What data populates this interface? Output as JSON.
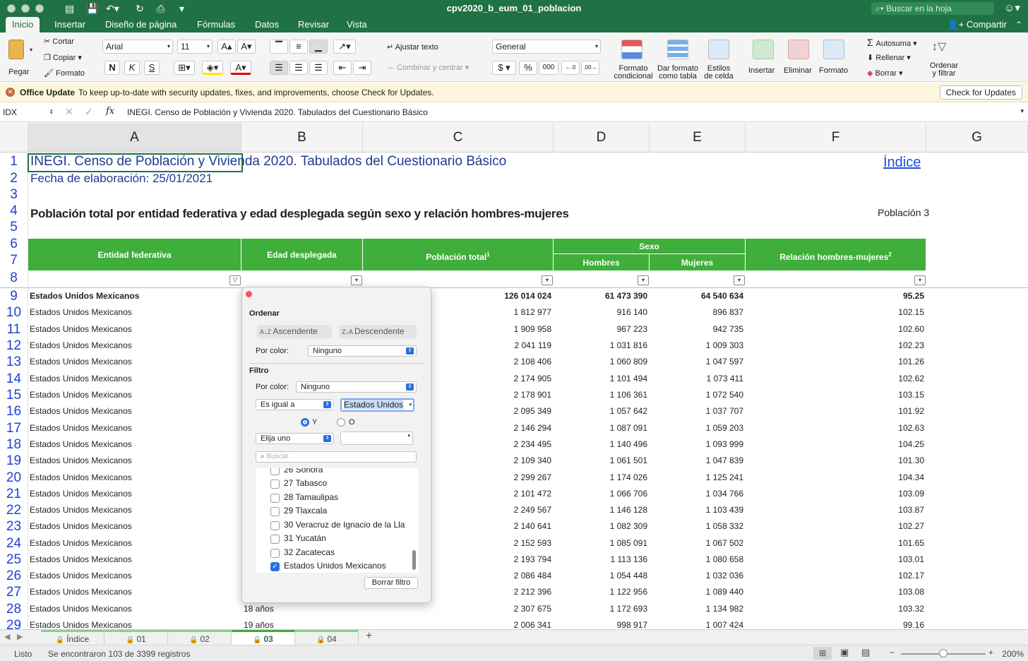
{
  "window": {
    "title": "cpv2020_b_eum_01_poblacion",
    "search_placeholder": "Buscar en la hoja"
  },
  "ribbon_tabs": [
    "Inicio",
    "Insertar",
    "Diseño de página",
    "Fórmulas",
    "Datos",
    "Revisar",
    "Vista"
  ],
  "share_label": "Compartir",
  "ribbon": {
    "paste": "Pegar",
    "cut": "Cortar",
    "copy": "Copiar",
    "format_painter": "Formato",
    "font_name": "Arial",
    "font_size": "11",
    "bold": "N",
    "italic": "K",
    "underline": "S",
    "wrap_text": "Ajustar texto",
    "merge_center": "Combinar y centrar",
    "number_format": "General",
    "currency": "$",
    "percent": "%",
    "thousands": "000",
    "cond_format": [
      "Formato",
      "condicional"
    ],
    "table_format": [
      "Dar formato",
      "como tabla"
    ],
    "cell_styles": [
      "Estilos",
      "de celda"
    ],
    "insert": "Insertar",
    "delete": "Eliminar",
    "format": "Formato",
    "autosum": "Autosuma",
    "fill": "Rellenar",
    "clear": "Borrar",
    "sort_filter": [
      "Ordenar",
      "y filtrar"
    ]
  },
  "update_bar": {
    "title": "Office Update",
    "message": "To keep up-to-date with security updates, fixes, and improvements, choose Check for Updates.",
    "button": "Check for Updates"
  },
  "formula_bar": {
    "name_box": "IDX",
    "fx": "fx",
    "content": "INEGI. Censo de Población y Vivienda 2020. Tabulados del Cuestionario Básico"
  },
  "columns": [
    "A",
    "B",
    "C",
    "D",
    "E",
    "F",
    "G"
  ],
  "sheet": {
    "title": "INEGI. Censo de Población y Vivienda 2020. Tabulados del Cuestionario Básico",
    "date": "Fecha de elaboración: 25/01/2021",
    "index_link": "Índice",
    "subtitle": "Población total por entidad federativa y edad desplegada según sexo y relación hombres-mujeres",
    "table_id": "Población 3",
    "headers": {
      "entity": "Entidad federativa",
      "age": "Edad desplegada",
      "total": "Población total",
      "total_sup": "1",
      "sex": "Sexo",
      "men": "Hombres",
      "women": "Mujeres",
      "ratio": "Relación hombres-mujeres",
      "ratio_sup": "2"
    }
  },
  "rows": [
    {
      "n": "9",
      "entity": "Estados Unidos Mexicanos",
      "age": "",
      "total": "126 014 024",
      "men": "61 473 390",
      "women": "64 540 634",
      "ratio": "95.25",
      "bold": true
    },
    {
      "n": "10",
      "entity": "Estados Unidos Mexicanos",
      "age": "",
      "total": "1 812 977",
      "men": "916 140",
      "women": "896 837",
      "ratio": "102.15"
    },
    {
      "n": "11",
      "entity": "Estados Unidos Mexicanos",
      "age": "",
      "total": "1 909 958",
      "men": "967 223",
      "women": "942 735",
      "ratio": "102.60"
    },
    {
      "n": "12",
      "entity": "Estados Unidos Mexicanos",
      "age": "",
      "total": "2 041 119",
      "men": "1 031 816",
      "women": "1 009 303",
      "ratio": "102.23"
    },
    {
      "n": "13",
      "entity": "Estados Unidos Mexicanos",
      "age": "",
      "total": "2 108 406",
      "men": "1 060 809",
      "women": "1 047 597",
      "ratio": "101.26"
    },
    {
      "n": "14",
      "entity": "Estados Unidos Mexicanos",
      "age": "",
      "total": "2 174 905",
      "men": "1 101 494",
      "women": "1 073 411",
      "ratio": "102.62"
    },
    {
      "n": "15",
      "entity": "Estados Unidos Mexicanos",
      "age": "",
      "total": "2 178 901",
      "men": "1 106 361",
      "women": "1 072 540",
      "ratio": "103.15"
    },
    {
      "n": "16",
      "entity": "Estados Unidos Mexicanos",
      "age": "",
      "total": "2 095 349",
      "men": "1 057 642",
      "women": "1 037 707",
      "ratio": "101.92"
    },
    {
      "n": "17",
      "entity": "Estados Unidos Mexicanos",
      "age": "",
      "total": "2 146 294",
      "men": "1 087 091",
      "women": "1 059 203",
      "ratio": "102.63"
    },
    {
      "n": "18",
      "entity": "Estados Unidos Mexicanos",
      "age": "",
      "total": "2 234 495",
      "men": "1 140 496",
      "women": "1 093 999",
      "ratio": "104.25"
    },
    {
      "n": "19",
      "entity": "Estados Unidos Mexicanos",
      "age": "",
      "total": "2 109 340",
      "men": "1 061 501",
      "women": "1 047 839",
      "ratio": "101.30"
    },
    {
      "n": "20",
      "entity": "Estados Unidos Mexicanos",
      "age": "",
      "total": "2 299 267",
      "men": "1 174 026",
      "women": "1 125 241",
      "ratio": "104.34"
    },
    {
      "n": "21",
      "entity": "Estados Unidos Mexicanos",
      "age": "",
      "total": "2 101 472",
      "men": "1 066 706",
      "women": "1 034 766",
      "ratio": "103.09"
    },
    {
      "n": "22",
      "entity": "Estados Unidos Mexicanos",
      "age": "",
      "total": "2 249 567",
      "men": "1 146 128",
      "women": "1 103 439",
      "ratio": "103.87"
    },
    {
      "n": "23",
      "entity": "Estados Unidos Mexicanos",
      "age": "",
      "total": "2 140 641",
      "men": "1 082 309",
      "women": "1 058 332",
      "ratio": "102.27"
    },
    {
      "n": "24",
      "entity": "Estados Unidos Mexicanos",
      "age": "",
      "total": "2 152 593",
      "men": "1 085 091",
      "women": "1 067 502",
      "ratio": "101.65"
    },
    {
      "n": "25",
      "entity": "Estados Unidos Mexicanos",
      "age": "",
      "total": "2 193 794",
      "men": "1 113 136",
      "women": "1 080 658",
      "ratio": "103.01"
    },
    {
      "n": "26",
      "entity": "Estados Unidos Mexicanos",
      "age": "",
      "total": "2 086 484",
      "men": "1 054 448",
      "women": "1 032 036",
      "ratio": "102.17"
    },
    {
      "n": "27",
      "entity": "Estados Unidos Mexicanos",
      "age": "",
      "total": "2 212 396",
      "men": "1 122 956",
      "women": "1 089 440",
      "ratio": "103.08"
    },
    {
      "n": "28",
      "entity": "Estados Unidos Mexicanos",
      "age": "18 años",
      "total": "2 307 675",
      "men": "1 172 693",
      "women": "1 134 982",
      "ratio": "103.32"
    },
    {
      "n": "29",
      "entity": "Estados Unidos Mexicanos",
      "age": "19 años",
      "total": "2 006 341",
      "men": "998 917",
      "women": "1 007 424",
      "ratio": "99.16"
    }
  ],
  "filter_popup": {
    "sort_label": "Ordenar",
    "ascending": "Ascendente",
    "descending": "Descendente",
    "by_color": "Por color:",
    "none": "Ninguno",
    "filter_label": "Filtro",
    "condition": "Es igual a",
    "condition_value": "Estados Unidos",
    "and": "Y",
    "or": "O",
    "choose": "Elija uno",
    "search_placeholder": "Buscar",
    "items": [
      {
        "label": "26 Sonora",
        "checked": false
      },
      {
        "label": "27 Tabasco",
        "checked": false
      },
      {
        "label": "28 Tamaulipas",
        "checked": false
      },
      {
        "label": "29 Tlaxcala",
        "checked": false
      },
      {
        "label": "30 Veracruz de Ignacio de la Lla",
        "checked": false
      },
      {
        "label": "31 Yucatán",
        "checked": false
      },
      {
        "label": "32 Zacatecas",
        "checked": false
      },
      {
        "label": "Estados Unidos Mexicanos",
        "checked": true
      }
    ],
    "clear_filter": "Borrar filtro"
  },
  "sheet_tabs": [
    {
      "label": "Índice",
      "active": false
    },
    {
      "label": "01",
      "active": false
    },
    {
      "label": "02",
      "active": false
    },
    {
      "label": "03",
      "active": true
    },
    {
      "label": "04",
      "active": false
    }
  ],
  "status": {
    "ready": "Listo",
    "records": "Se encontraron 103 de 3399 registros",
    "zoom": "200%"
  },
  "colors": {
    "excel_green": "#207245",
    "header_green": "#3fae3a",
    "row_number_blue": "#1f3fd6",
    "title_blue": "#1f3a93"
  }
}
